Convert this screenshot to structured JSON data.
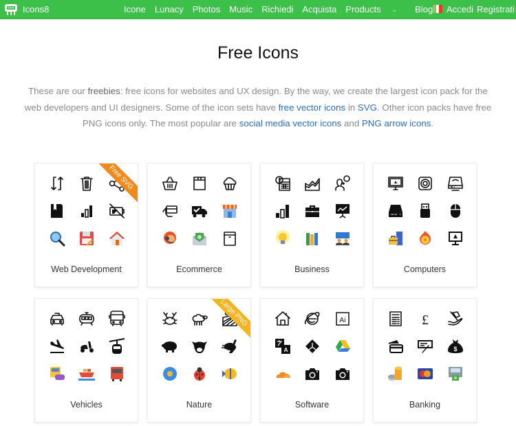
{
  "nav": {
    "brand": "Icons8",
    "items": [
      "Icone",
      "Lunacy",
      "Photos",
      "Music",
      "Richiedi",
      "Acquista",
      "Products",
      "Blog"
    ],
    "language_flag": "italy-flag",
    "login": "Accedi",
    "register": "Registrati",
    "colors": {
      "bar": "#3cc04a"
    }
  },
  "page": {
    "title": "Free Icons",
    "intro": {
      "p1": "These are our ",
      "freebies": "freebies",
      "p2": ": free icons for websites and UX design. By the way, we create the largest icon pack for the web developers and UI designers. Some of the icon sets have ",
      "link1": "free vector icons",
      "p3": " in ",
      "link2": "SVG",
      "p4": ". Other icon packs have free PNG icons only. The most popular are ",
      "link3": "social media vector icons",
      "p5": " and ",
      "link4": "PNG arrow icons",
      "p6": "."
    }
  },
  "cards": [
    {
      "title": "Web Development",
      "ribbon": "Free SVG",
      "ribbon_color": "#f08a1c",
      "icons": [
        "sync-icon",
        "trash-icon",
        "share-icon",
        "bookmark-book-icon",
        "signal-bars-icon",
        "no-battery-icon",
        "search-icon",
        "save-floppy-icon",
        "home-icon"
      ]
    },
    {
      "title": "Ecommerce",
      "ribbon": null,
      "icons": [
        "shopping-basket-icon",
        "package-icon",
        "cupcake-icon",
        "card-payment-icon",
        "delivery-truck-icon",
        "shop-icon",
        "support-agent-icon",
        "money-envelope-icon",
        "box-icon"
      ]
    },
    {
      "title": "Business",
      "ribbon": null,
      "icons": [
        "calendar-clock-icon",
        "area-chart-icon",
        "thinking-person-icon",
        "bar-chart-icon",
        "briefcase-icon",
        "presentation-icon",
        "idea-bulb-icon",
        "books-icon",
        "conference-icon"
      ]
    },
    {
      "title": "Computers",
      "ribbon": null,
      "icons": [
        "linux-monitor-icon",
        "speaker-icon",
        "phone-modem-icon",
        "hard-drive-icon",
        "usb-drive-icon",
        "mouse-icon",
        "workstation-icon",
        "burn-disc-icon",
        "linux-screen-icon"
      ]
    },
    {
      "title": "Vehicles",
      "ribbon": null,
      "icons": [
        "taxi-icon",
        "tram-icon",
        "bus-icon",
        "airplane-landing-icon",
        "scooter-icon",
        "cable-car-icon",
        "traffic-jam-icon",
        "cargo-ship-icon",
        "truck-icon"
      ]
    },
    {
      "title": "Nature",
      "ribbon": "Large PNG",
      "ribbon_color": "#f6b51c",
      "icons": [
        "crab-icon",
        "sheep-icon",
        "field-icon",
        "pig-icon",
        "cow-icon",
        "rabbit-icon",
        "flower-icon",
        "ladybug-icon",
        "fish-icon"
      ]
    },
    {
      "title": "Software",
      "ribbon": null,
      "icons": [
        "home-outline-icon",
        "internet-explorer-icon",
        "adobe-illustrator-icon",
        "translate-icon",
        "google-drive-black-icon",
        "google-drive-icon",
        "cloudflare-icon",
        "camera-icon",
        "camera-filled-icon"
      ]
    },
    {
      "title": "Banking",
      "ribbon": null,
      "icons": [
        "invoice-icon",
        "pound-icon",
        "receive-cash-icon",
        "credit-cards-icon",
        "check-signature-icon",
        "money-bag-icon",
        "coins-icon",
        "mastercard-icon",
        "atm-icon"
      ]
    }
  ]
}
